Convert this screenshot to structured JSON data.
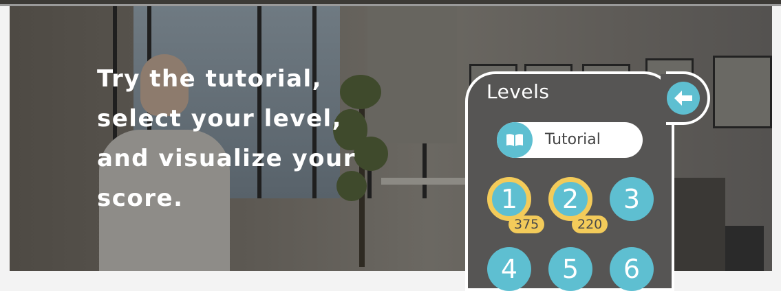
{
  "intro": {
    "lines": [
      "Try the tutorial,",
      "select your level,",
      "and visualize your",
      "score."
    ]
  },
  "levels_panel": {
    "title": "Levels",
    "back_icon": "arrow-left-icon",
    "tutorial": {
      "label": "Tutorial",
      "icon": "book-icon"
    },
    "levels": [
      {
        "number": "1",
        "completed": true,
        "score": "375"
      },
      {
        "number": "2",
        "completed": true,
        "score": "220"
      },
      {
        "number": "3",
        "completed": false
      },
      {
        "number": "4",
        "completed": false
      },
      {
        "number": "5",
        "completed": false
      },
      {
        "number": "6",
        "completed": false
      }
    ]
  },
  "colors": {
    "accent": "#5ebfd1",
    "score": "#f3cb5a",
    "panel": "#565554",
    "text_light": "#ffffff"
  }
}
